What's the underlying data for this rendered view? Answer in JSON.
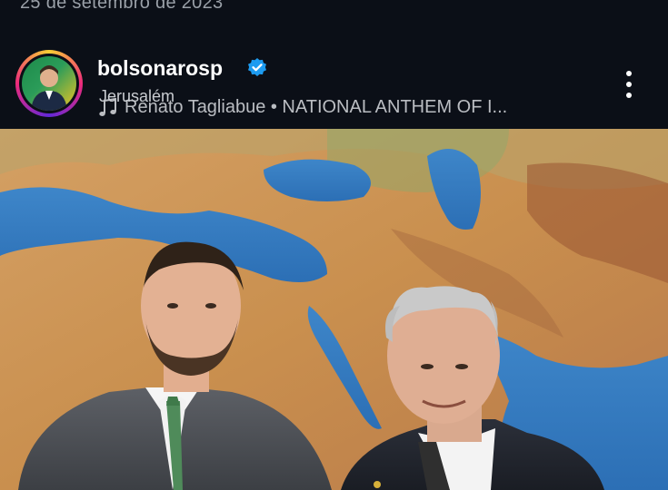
{
  "post": {
    "date": "25 de setembro de 2023",
    "username": "bolsonarosp",
    "location": "Jerusalém",
    "audio": "Renato Tagliabue • NATIONAL ANTHEM OF I..."
  },
  "icons": {
    "verified": "verified-badge-icon",
    "music": "music-note-icon",
    "more": "more-options-icon"
  },
  "colors": {
    "background": "#0b0f17",
    "verified": "#1d9bf0"
  }
}
